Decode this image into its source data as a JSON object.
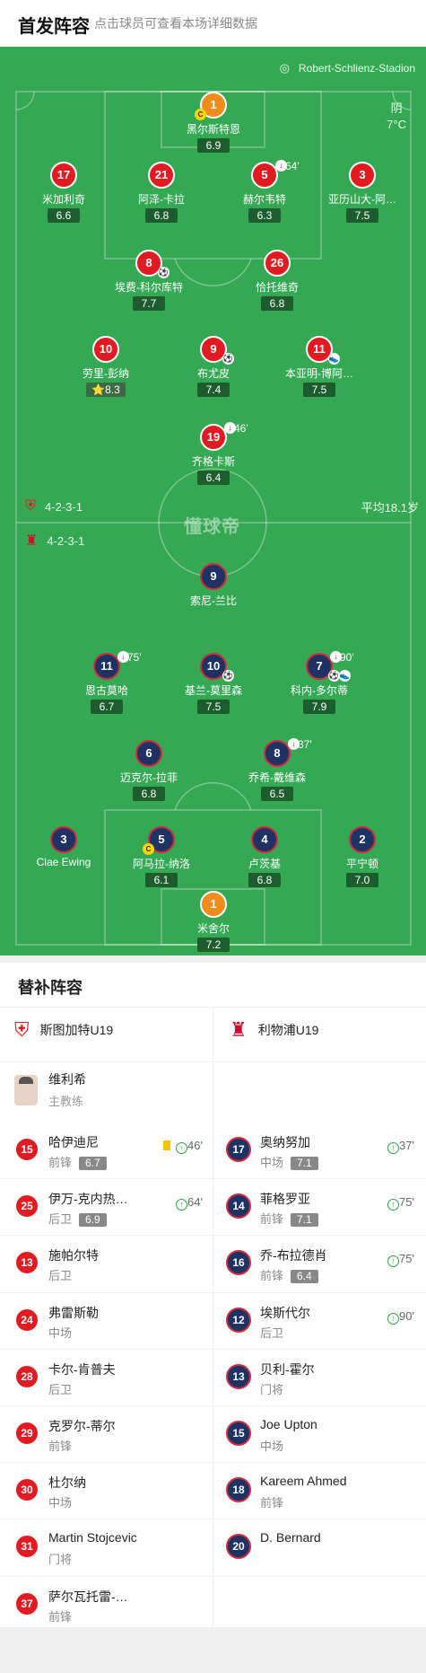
{
  "header": {
    "title": "首发阵容",
    "subtitle": "点击球员可查看本场详细数据"
  },
  "pitch": {
    "stadium": "Robert-Schlienz-Stadion",
    "weather_desc": "阴",
    "weather_temp": "7°C",
    "home_formation": "4-2-3-1",
    "away_formation": "4-2-3-1",
    "avg_age": "平均18.1岁",
    "watermark": "懂球帝"
  },
  "home_players": [
    {
      "num": "1",
      "name": "黑尔斯特恩",
      "rating": "6.9"
    },
    {
      "num": "17",
      "name": "米加利奇",
      "rating": "6.6"
    },
    {
      "num": "21",
      "name": "阿泽-卡拉",
      "rating": "6.8"
    },
    {
      "num": "5",
      "name": "赫尔韦特",
      "rating": "6.3",
      "sub": "64'"
    },
    {
      "num": "3",
      "name": "亚历山大-阿…",
      "rating": "7.5"
    },
    {
      "num": "8",
      "name": "埃费-科尔库特",
      "rating": "7.7"
    },
    {
      "num": "26",
      "name": "恰托维奇",
      "rating": "6.8"
    },
    {
      "num": "10",
      "name": "劳里-彭纳",
      "rating": "8.3"
    },
    {
      "num": "9",
      "name": "布尤皮",
      "rating": "7.4"
    },
    {
      "num": "11",
      "name": "本亚明-博阿…",
      "rating": "7.5"
    },
    {
      "num": "19",
      "name": "齐格卡斯",
      "rating": "6.4",
      "sub": "46'"
    }
  ],
  "away_players": [
    {
      "num": "9",
      "name": "索尼-兰比"
    },
    {
      "num": "11",
      "name": "恩古莫哈",
      "rating": "6.7",
      "sub": "75'"
    },
    {
      "num": "10",
      "name": "基兰-莫里森",
      "rating": "7.5"
    },
    {
      "num": "7",
      "name": "科内-多尔蒂",
      "rating": "7.9",
      "sub": "90'"
    },
    {
      "num": "6",
      "name": "迈克尔-拉菲",
      "rating": "6.8"
    },
    {
      "num": "8",
      "name": "乔希-戴维森",
      "rating": "6.5",
      "sub": "37'"
    },
    {
      "num": "3",
      "name": "Clae Ewing"
    },
    {
      "num": "5",
      "name": "阿马拉-纳洛",
      "rating": "6.1"
    },
    {
      "num": "4",
      "name": "卢茨基",
      "rating": "6.8"
    },
    {
      "num": "2",
      "name": "平宁顿",
      "rating": "7.0"
    },
    {
      "num": "1",
      "name": "米舍尔",
      "rating": "7.2"
    }
  ],
  "subs": {
    "title": "替补阵容",
    "home_team": "斯图加特U19",
    "away_team": "利物浦U19",
    "coach_name": "维利希",
    "coach_role": "主教练",
    "home": [
      {
        "num": "15",
        "name": "哈伊迪尼",
        "pos": "前锋",
        "rating": "6.7",
        "time": "46'"
      },
      {
        "num": "25",
        "name": "伊万-克内热…",
        "pos": "后卫",
        "rating": "6.9",
        "time": "64'"
      },
      {
        "num": "13",
        "name": "施帕尔特",
        "pos": "后卫"
      },
      {
        "num": "24",
        "name": "弗雷斯勒",
        "pos": "中场"
      },
      {
        "num": "28",
        "name": "卡尔-肯普夫",
        "pos": "后卫"
      },
      {
        "num": "29",
        "name": "克罗尔-蒂尔",
        "pos": "前锋"
      },
      {
        "num": "30",
        "name": "杜尔纳",
        "pos": "中场"
      },
      {
        "num": "31",
        "name": "Martin Stojcevic",
        "pos": "门将"
      },
      {
        "num": "37",
        "name": "萨尔瓦托雷-…",
        "pos": "前锋"
      }
    ],
    "away": [
      {
        "num": "17",
        "name": "奥纳努加",
        "pos": "中场",
        "rating": "7.1",
        "time": "37'"
      },
      {
        "num": "14",
        "name": "菲格罗亚",
        "pos": "前锋",
        "rating": "7.1",
        "time": "75'"
      },
      {
        "num": "16",
        "name": "乔-布拉德肖",
        "pos": "前锋",
        "rating": "6.4",
        "time": "75'"
      },
      {
        "num": "12",
        "name": "埃斯代尔",
        "pos": "后卫",
        "time": "90'"
      },
      {
        "num": "13",
        "name": "贝利-霍尔",
        "pos": "门将"
      },
      {
        "num": "15",
        "name": "Joe Upton",
        "pos": "中场"
      },
      {
        "num": "18",
        "name": "Kareem Ahmed",
        "pos": "前锋"
      },
      {
        "num": "20",
        "name": "D. Bernard"
      }
    ]
  },
  "icons": {
    "captain": "C",
    "sub_arrow": "↓",
    "sub_in": "↑",
    "ball": "⚽",
    "star": "⭐"
  },
  "colors": {
    "pitch": "#34a853",
    "home": "#e21b23",
    "away": "#1f3264",
    "keeper": "#f08c1c"
  }
}
